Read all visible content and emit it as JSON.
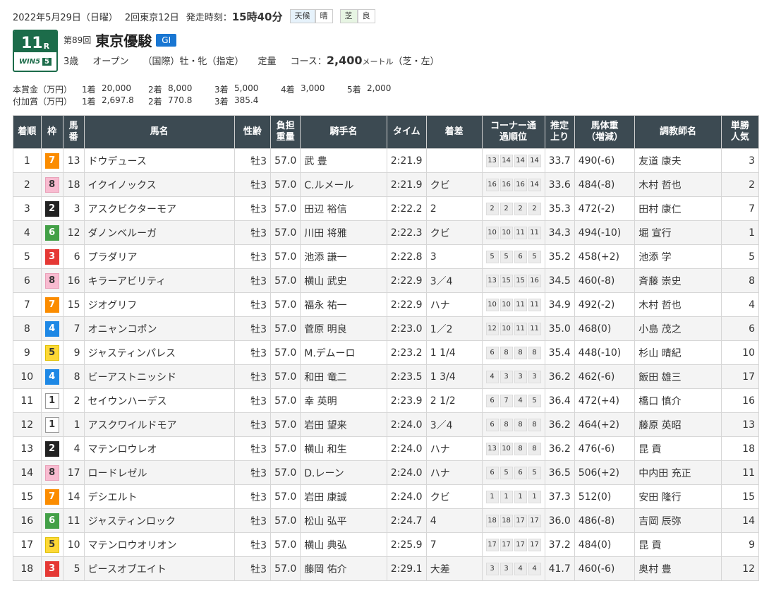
{
  "race": {
    "date": "2022年5月29日（日曜）",
    "meeting": "2回東京12日",
    "post_time_label": "発走時刻：",
    "post_time": "15時40分",
    "weather_label": "天候",
    "weather": "晴",
    "track_label": "芝",
    "track_cond": "良",
    "race_number": "11",
    "race_suffix": "R",
    "win5_label": "WIN5",
    "win5_num": "5",
    "kai": "第89回",
    "name": "東京優駿",
    "grade": "GI",
    "age": "3歳",
    "class": "オープン",
    "intl": "（国際）牡・牝（指定）",
    "weight_rule": "定量",
    "course_label": "コース：",
    "distance": "2,400",
    "unit": "メートル",
    "surface": "（芝・左）"
  },
  "prize": {
    "main_label": "本賞金（万円）",
    "main": [
      {
        "place": "1着",
        "amount": "20,000"
      },
      {
        "place": "2着",
        "amount": "8,000"
      },
      {
        "place": "3着",
        "amount": "5,000"
      },
      {
        "place": "4着",
        "amount": "3,000"
      },
      {
        "place": "5着",
        "amount": "2,000"
      }
    ],
    "add_label": "付加賞（万円）",
    "add": [
      {
        "place": "1着",
        "amount": "2,697.8"
      },
      {
        "place": "2着",
        "amount": "770.8"
      },
      {
        "place": "3着",
        "amount": "385.4"
      }
    ]
  },
  "table": {
    "headers": [
      "着順",
      "枠",
      "馬番",
      "馬名",
      "性齢",
      "負担重量",
      "騎手名",
      "タイム",
      "着差",
      "コーナー通過順位",
      "推定上り",
      "馬体重（増減）",
      "調教師名",
      "単勝人気"
    ],
    "rows": [
      {
        "pos": "1",
        "waku": "7",
        "num": "13",
        "horse": "ドウデュース",
        "sex": "牡3",
        "wt": "57.0",
        "jockey": "武 豊",
        "time": "2:21.9",
        "margin": "",
        "corner": [
          "13",
          "14",
          "14",
          "14"
        ],
        "last": "33.7",
        "bw": "490(-6)",
        "trainer": "友道 康夫",
        "pop": "3"
      },
      {
        "pos": "2",
        "waku": "8",
        "num": "18",
        "horse": "イクイノックス",
        "sex": "牡3",
        "wt": "57.0",
        "jockey": "C.ルメール",
        "time": "2:21.9",
        "margin": "クビ",
        "corner": [
          "16",
          "16",
          "16",
          "14"
        ],
        "last": "33.6",
        "bw": "484(-8)",
        "trainer": "木村 哲也",
        "pop": "2"
      },
      {
        "pos": "3",
        "waku": "2",
        "num": "3",
        "horse": "アスクビクターモア",
        "sex": "牡3",
        "wt": "57.0",
        "jockey": "田辺 裕信",
        "time": "2:22.2",
        "margin": "2",
        "corner": [
          "2",
          "2",
          "2",
          "2"
        ],
        "last": "35.3",
        "bw": "472(-2)",
        "trainer": "田村 康仁",
        "pop": "7"
      },
      {
        "pos": "4",
        "waku": "6",
        "num": "12",
        "horse": "ダノンベルーガ",
        "sex": "牡3",
        "wt": "57.0",
        "jockey": "川田 将雅",
        "time": "2:22.3",
        "margin": "クビ",
        "corner": [
          "10",
          "10",
          "11",
          "11"
        ],
        "last": "34.3",
        "bw": "494(-10)",
        "trainer": "堀 宣行",
        "pop": "1"
      },
      {
        "pos": "5",
        "waku": "3",
        "num": "6",
        "horse": "プラダリア",
        "sex": "牡3",
        "wt": "57.0",
        "jockey": "池添 謙一",
        "time": "2:22.8",
        "margin": "3",
        "corner": [
          "5",
          "5",
          "6",
          "5"
        ],
        "last": "35.2",
        "bw": "458(+2)",
        "trainer": "池添 学",
        "pop": "5"
      },
      {
        "pos": "6",
        "waku": "8",
        "num": "16",
        "horse": "キラーアビリティ",
        "sex": "牡3",
        "wt": "57.0",
        "jockey": "横山 武史",
        "time": "2:22.9",
        "margin": "3／4",
        "corner": [
          "13",
          "15",
          "15",
          "16"
        ],
        "last": "34.5",
        "bw": "460(-8)",
        "trainer": "斉藤 崇史",
        "pop": "8"
      },
      {
        "pos": "7",
        "waku": "7",
        "num": "15",
        "horse": "ジオグリフ",
        "sex": "牡3",
        "wt": "57.0",
        "jockey": "福永 祐一",
        "time": "2:22.9",
        "margin": "ハナ",
        "corner": [
          "10",
          "10",
          "11",
          "11"
        ],
        "last": "34.9",
        "bw": "492(-2)",
        "trainer": "木村 哲也",
        "pop": "4"
      },
      {
        "pos": "8",
        "waku": "4",
        "num": "7",
        "horse": "オニャンコポン",
        "sex": "牡3",
        "wt": "57.0",
        "jockey": "菅原 明良",
        "time": "2:23.0",
        "margin": "1／2",
        "corner": [
          "12",
          "10",
          "11",
          "11"
        ],
        "last": "35.0",
        "bw": "468(0)",
        "trainer": "小島 茂之",
        "pop": "6"
      },
      {
        "pos": "9",
        "waku": "5",
        "num": "9",
        "horse": "ジャスティンパレス",
        "sex": "牡3",
        "wt": "57.0",
        "jockey": "M.デムーロ",
        "time": "2:23.2",
        "margin": "1 1/4",
        "corner": [
          "6",
          "8",
          "8",
          "8"
        ],
        "last": "35.4",
        "bw": "448(-10)",
        "trainer": "杉山 晴紀",
        "pop": "10"
      },
      {
        "pos": "10",
        "waku": "4",
        "num": "8",
        "horse": "ビーアストニッシド",
        "sex": "牡3",
        "wt": "57.0",
        "jockey": "和田 竜二",
        "time": "2:23.5",
        "margin": "1 3/4",
        "corner": [
          "4",
          "3",
          "3",
          "3"
        ],
        "last": "36.2",
        "bw": "462(-6)",
        "trainer": "飯田 雄三",
        "pop": "17"
      },
      {
        "pos": "11",
        "waku": "1",
        "num": "2",
        "horse": "セイウンハーデス",
        "sex": "牡3",
        "wt": "57.0",
        "jockey": "幸 英明",
        "time": "2:23.9",
        "margin": "2 1/2",
        "corner": [
          "6",
          "7",
          "4",
          "5"
        ],
        "last": "36.4",
        "bw": "472(+4)",
        "trainer": "橋口 慎介",
        "pop": "16"
      },
      {
        "pos": "12",
        "waku": "1",
        "num": "1",
        "horse": "アスクワイルドモア",
        "sex": "牡3",
        "wt": "57.0",
        "jockey": "岩田 望来",
        "time": "2:24.0",
        "margin": "3／4",
        "corner": [
          "6",
          "8",
          "8",
          "8"
        ],
        "last": "36.2",
        "bw": "464(+2)",
        "trainer": "藤原 英昭",
        "pop": "13"
      },
      {
        "pos": "13",
        "waku": "2",
        "num": "4",
        "horse": "マテンロウレオ",
        "sex": "牡3",
        "wt": "57.0",
        "jockey": "横山 和生",
        "time": "2:24.0",
        "margin": "ハナ",
        "corner": [
          "13",
          "10",
          "8",
          "8"
        ],
        "last": "36.2",
        "bw": "476(-6)",
        "trainer": "昆 貢",
        "pop": "18"
      },
      {
        "pos": "14",
        "waku": "8",
        "num": "17",
        "horse": "ロードレゼル",
        "sex": "牡3",
        "wt": "57.0",
        "jockey": "D.レーン",
        "time": "2:24.0",
        "margin": "ハナ",
        "corner": [
          "6",
          "5",
          "6",
          "5"
        ],
        "last": "36.5",
        "bw": "506(+2)",
        "trainer": "中内田 充正",
        "pop": "11"
      },
      {
        "pos": "15",
        "waku": "7",
        "num": "14",
        "horse": "デシエルト",
        "sex": "牡3",
        "wt": "57.0",
        "jockey": "岩田 康誠",
        "time": "2:24.0",
        "margin": "クビ",
        "corner": [
          "1",
          "1",
          "1",
          "1"
        ],
        "last": "37.3",
        "bw": "512(0)",
        "trainer": "安田 隆行",
        "pop": "15"
      },
      {
        "pos": "16",
        "waku": "6",
        "num": "11",
        "horse": "ジャスティンロック",
        "sex": "牡3",
        "wt": "57.0",
        "jockey": "松山 弘平",
        "time": "2:24.7",
        "margin": "4",
        "corner": [
          "18",
          "18",
          "17",
          "17"
        ],
        "last": "36.0",
        "bw": "486(-8)",
        "trainer": "吉岡 辰弥",
        "pop": "14"
      },
      {
        "pos": "17",
        "waku": "5",
        "num": "10",
        "horse": "マテンロウオリオン",
        "sex": "牡3",
        "wt": "57.0",
        "jockey": "横山 典弘",
        "time": "2:25.9",
        "margin": "7",
        "corner": [
          "17",
          "17",
          "17",
          "17"
        ],
        "last": "37.2",
        "bw": "484(0)",
        "trainer": "昆 貢",
        "pop": "9"
      },
      {
        "pos": "18",
        "waku": "3",
        "num": "5",
        "horse": "ピースオブエイト",
        "sex": "牡3",
        "wt": "57.0",
        "jockey": "藤岡 佑介",
        "time": "2:29.1",
        "margin": "大差",
        "corner": [
          "3",
          "3",
          "4",
          "4"
        ],
        "last": "41.7",
        "bw": "460(-6)",
        "trainer": "奥村 豊",
        "pop": "12"
      }
    ]
  }
}
